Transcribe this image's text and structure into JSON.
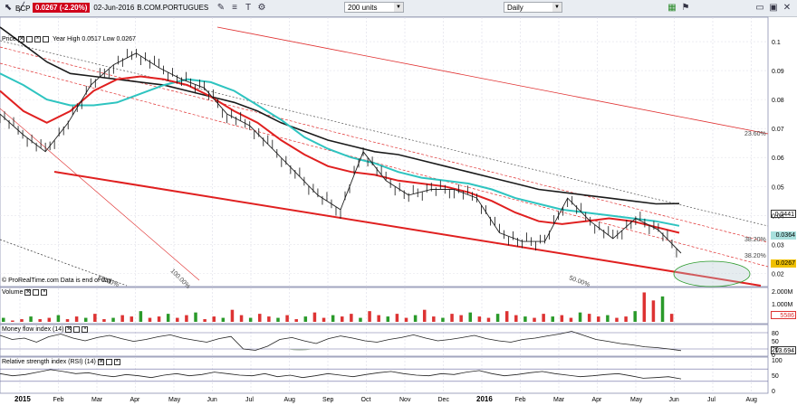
{
  "toolbar": {
    "ticker": "BCP",
    "quote": "0.0267 (-2.20%)",
    "date": "02-Jun-2016",
    "instrument": "B.COM.PORTUGUES",
    "units": "200 units",
    "period": "Daily"
  },
  "panels": {
    "price": {
      "title": "Price",
      "stats": "Year High 0.0517 Low 0.0267",
      "source": "© ProRealTime.com  Data is end of day"
    },
    "volume": {
      "title": "Volume"
    },
    "mfi": {
      "title": "Money flow index (14)"
    },
    "rsi": {
      "title": "Relative strength index (RSI) (14)"
    }
  },
  "price_axis": [
    "0.1",
    "0.09",
    "0.08",
    "0.07",
    "0.06",
    "0.05",
    "0.04",
    "0.03",
    "0.02"
  ],
  "price_tags": [
    {
      "label": "0.0441",
      "color": "#1a1a1a",
      "bg": "#ffffff"
    },
    {
      "label": "0.0364",
      "color": "#1a1a1a",
      "bg": "#a8e0dd"
    },
    {
      "label": "0.0267",
      "color": "#000000",
      "bg": "#f0c000"
    }
  ],
  "volume_axis": [
    "2.000M",
    "1.000M"
  ],
  "volume_tag": "5586",
  "mfi_axis": [
    "80",
    "50",
    "20",
    "0"
  ],
  "mfi_tag": "13.694",
  "rsi_axis": [
    "100",
    "50",
    "0"
  ],
  "fib_labels": [
    "23.60%",
    "38.20%",
    "38.20%",
    "50.00%",
    "100.00%",
    "50.00%"
  ],
  "chart_data": {
    "type": "line",
    "months": [
      "2015",
      "Feb",
      "Mar",
      "Apr",
      "May",
      "Jun",
      "Jul",
      "Aug",
      "Sep",
      "Oct",
      "Nov",
      "Dec",
      "2016",
      "Feb",
      "Mar",
      "Apr",
      "May",
      "Jun",
      "Jul",
      "Aug"
    ],
    "ylim": [
      0.017,
      0.105
    ],
    "price": [
      0.075,
      0.068,
      0.062,
      0.072,
      0.085,
      0.092,
      0.096,
      0.091,
      0.087,
      0.084,
      0.075,
      0.071,
      0.063,
      0.055,
      0.047,
      0.042,
      0.062,
      0.052,
      0.047,
      0.049,
      0.049,
      0.046,
      0.034,
      0.031,
      0.031,
      0.046,
      0.038,
      0.032,
      0.039,
      0.035,
      0.027
    ],
    "ma_black": [
      0.105,
      0.099,
      0.093,
      0.089,
      0.088,
      0.087,
      0.086,
      0.085,
      0.083,
      0.081,
      0.079,
      0.076,
      0.072,
      0.069,
      0.066,
      0.064,
      0.062,
      0.061,
      0.059,
      0.057,
      0.055,
      0.053,
      0.051,
      0.049,
      0.048,
      0.047,
      0.046,
      0.045,
      0.044,
      0.0441
    ],
    "ma_cyan": [
      0.089,
      0.085,
      0.08,
      0.078,
      0.078,
      0.079,
      0.082,
      0.085,
      0.087,
      0.086,
      0.083,
      0.078,
      0.073,
      0.067,
      0.063,
      0.06,
      0.058,
      0.055,
      0.053,
      0.052,
      0.051,
      0.049,
      0.046,
      0.044,
      0.042,
      0.041,
      0.04,
      0.039,
      0.038,
      0.0364
    ],
    "ma_red": [
      0.083,
      0.076,
      0.072,
      0.076,
      0.083,
      0.087,
      0.088,
      0.087,
      0.085,
      0.081,
      0.076,
      0.072,
      0.066,
      0.061,
      0.057,
      0.055,
      0.054,
      0.052,
      0.051,
      0.05,
      0.048,
      0.045,
      0.041,
      0.038,
      0.037,
      0.038,
      0.039,
      0.038,
      0.036,
      0.034
    ],
    "volume": [
      0.3,
      0.1,
      0.2,
      0.4,
      0.2,
      0.3,
      0.5,
      0.2,
      0.4,
      0.3,
      0.6,
      0.2,
      0.3,
      0.5,
      0.4,
      0.8,
      0.3,
      0.4,
      0.6,
      0.3,
      0.5,
      0.7,
      0.2,
      0.4,
      0.3,
      0.9,
      0.5,
      0.3,
      0.6,
      0.4,
      0.3,
      0.5,
      0.2,
      0.4,
      0.7,
      0.3,
      0.5,
      0.4,
      0.6,
      0.3,
      0.8,
      0.5,
      0.4,
      0.6,
      0.3,
      0.5,
      0.9,
      0.4,
      0.3,
      0.6,
      0.5,
      0.7,
      0.4,
      0.3,
      0.6,
      0.8,
      0.5,
      0.4,
      0.3,
      0.6,
      0.4,
      0.5,
      0.3,
      0.7,
      0.6,
      0.4,
      0.5,
      0.3,
      0.4,
      0.8,
      2.2,
      1.6,
      1.9,
      0.6
    ],
    "mfi": [
      70,
      55,
      60,
      45,
      65,
      75,
      60,
      50,
      62,
      70,
      58,
      48,
      55,
      65,
      72,
      60,
      52,
      45,
      58,
      66,
      20,
      15,
      30,
      55,
      62,
      50,
      40,
      58,
      68,
      60,
      50,
      45,
      55,
      62,
      72,
      60,
      50,
      55,
      62,
      70,
      58,
      50,
      45,
      55,
      60,
      68,
      75,
      85,
      70,
      55,
      48,
      40,
      35,
      28,
      25,
      20,
      14
    ],
    "rsi": [
      55,
      48,
      52,
      60,
      68,
      62,
      55,
      58,
      50,
      45,
      52,
      48,
      42,
      50,
      55,
      48,
      52,
      60,
      55,
      50,
      48,
      55,
      45,
      50,
      42,
      48,
      55,
      50,
      45,
      52,
      58,
      62,
      55,
      50,
      48,
      55,
      52,
      60,
      65,
      55,
      48,
      52,
      58,
      62,
      55,
      50,
      45,
      48,
      52,
      55,
      48,
      40,
      42,
      45,
      38
    ]
  }
}
